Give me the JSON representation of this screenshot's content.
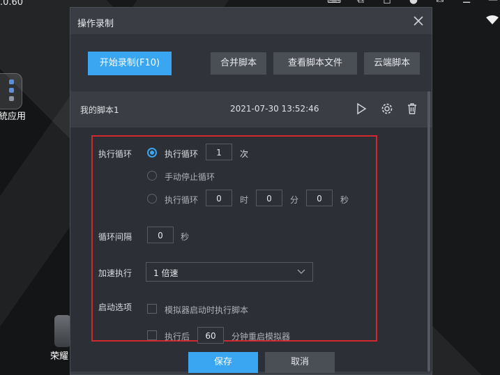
{
  "desktop": {
    "version_text": ".0.60",
    "folder_label": "統应用",
    "game_label": "荣耀"
  },
  "dialog": {
    "title": "操作录制",
    "toolbar": {
      "start_label": "开始录制(F10)",
      "merge_label": "合并脚本",
      "view_label": "查看脚本文件",
      "cloud_label": "云端脚本"
    },
    "script": {
      "name": "我的脚本1",
      "time": "2021-07-30 13:52:46"
    },
    "settings": {
      "loop_label": "执行循环",
      "opt_loop_times_label": "执行循环",
      "opt_loop_times_value": "1",
      "opt_loop_times_unit": "次",
      "opt_manual_label": "手动停止循环",
      "opt_loop_duration_label": "执行循环",
      "hours_value": "0",
      "hours_unit": "时",
      "minutes_value": "0",
      "minutes_unit": "分",
      "seconds_value": "0",
      "seconds_unit": "秒",
      "interval_label": "循环间隔",
      "interval_value": "0",
      "interval_unit": "秒",
      "speed_label": "加速执行",
      "speed_value": "1 倍速",
      "startup_label": "启动选项",
      "startup_run_label": "模拟器启动时执行脚本",
      "restart_prefix": "执行后",
      "restart_value": "60",
      "restart_suffix": "分钟重启模拟器"
    },
    "footer": {
      "save_label": "保存",
      "cancel_label": "取消"
    }
  },
  "colors": {
    "accent": "#3aa5f0",
    "highlight_frame": "#d0282d",
    "dialog_bg": "#3a3d43"
  }
}
